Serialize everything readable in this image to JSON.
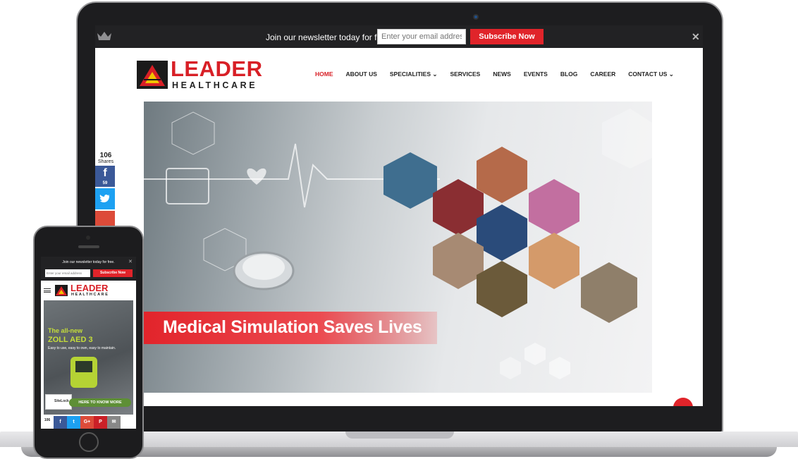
{
  "desktop": {
    "newsletter": {
      "text": "Join our newsletter today for free.",
      "email_placeholder": "Enter your email address",
      "subscribe_label": "Subscribe Now",
      "close_label": "✕"
    },
    "logo": {
      "word": "LEADER",
      "subword": "HEALTHCARE"
    },
    "nav": {
      "items": [
        {
          "label": "HOME"
        },
        {
          "label": "ABOUT US"
        },
        {
          "label": "SPECIALITIES ⌄"
        },
        {
          "label": "SERVICES"
        },
        {
          "label": "NEWS"
        },
        {
          "label": "EVENTS"
        },
        {
          "label": "BLOG"
        },
        {
          "label": "CAREER"
        },
        {
          "label": "CONTACT US ⌄"
        }
      ],
      "active_index": 0
    },
    "hero": {
      "title": "Medical Simulation Saves Lives",
      "slide_count": 6,
      "active_slide": 1
    },
    "share": {
      "count": "106",
      "label": "Shares",
      "facebook_count": "59",
      "facebook_glyph": "f"
    }
  },
  "mobile": {
    "newsletter": {
      "text": "Join our newsletter today for free.",
      "email_placeholder": "Enter your email address",
      "subscribe_label": "Subscribe Now",
      "close_label": "✕"
    },
    "logo": {
      "word": "LEADER",
      "subword": "HEALTHCARE"
    },
    "hero": {
      "line1": "The all-new",
      "line2": "ZOLL AED 3",
      "line3": "Easy to use, easy to own, easy to maintain.",
      "cta_label": "HERE TO KNOW MORE",
      "sitelock_label": "SiteLock"
    },
    "share": {
      "count": "106",
      "label": "Shares",
      "buttons": [
        {
          "label": "f",
          "color": "#3b5998"
        },
        {
          "label": "t",
          "color": "#1da1f2"
        },
        {
          "label": "G+",
          "color": "#dd4b39"
        },
        {
          "label": "P",
          "color": "#cb2027"
        },
        {
          "label": "✉",
          "color": "#888888"
        }
      ]
    }
  },
  "colors": {
    "brand_red": "#d81f26",
    "dark_bar": "#222224",
    "facebook": "#3b5998",
    "twitter": "#1da1f2",
    "google": "#dd4b39"
  }
}
